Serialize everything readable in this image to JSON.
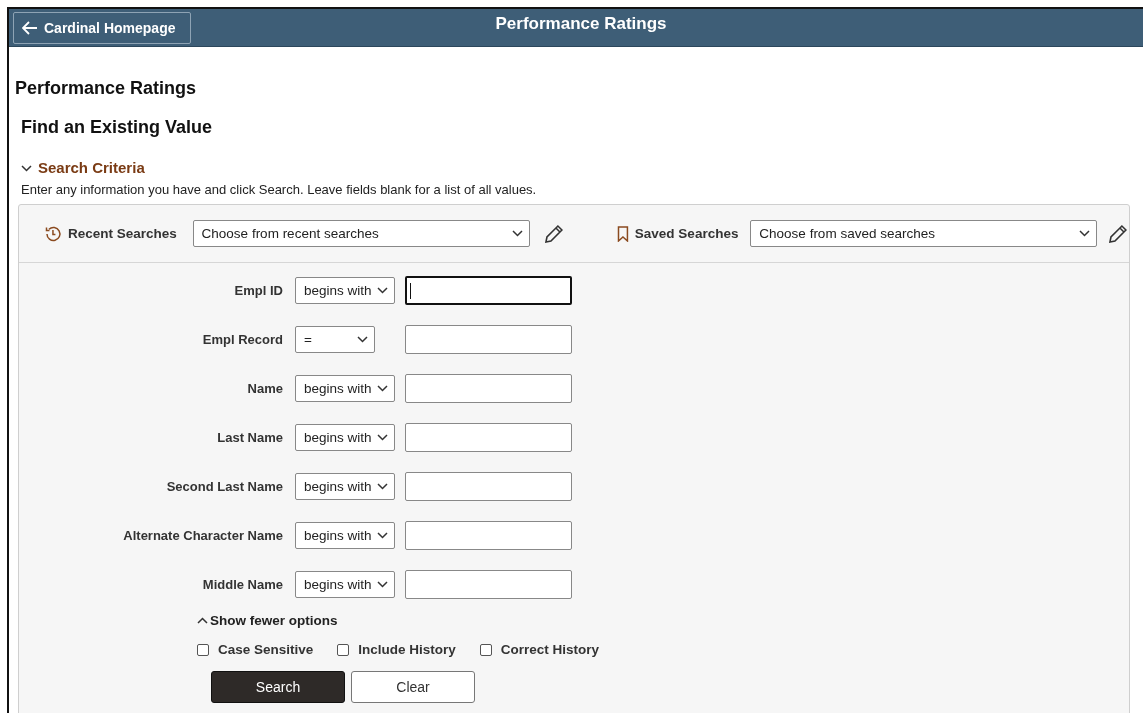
{
  "header": {
    "back_button": "Cardinal Homepage",
    "title": "Performance Ratings"
  },
  "page_title": "Performance Ratings",
  "subtitle": "Find an Existing Value",
  "section": {
    "title": "Search Criteria",
    "expanded": true,
    "instructions": "Enter any information you have and click Search. Leave fields blank for a list of all values."
  },
  "recent_searches": {
    "label": "Recent Searches",
    "value": "Choose from recent searches"
  },
  "saved_searches": {
    "label": "Saved Searches",
    "value": "Choose from saved searches"
  },
  "fields": [
    {
      "label": "Empl ID",
      "operator": "begins with",
      "focused": true
    },
    {
      "label": "Empl Record",
      "operator": "=",
      "focused": false
    },
    {
      "label": "Name",
      "operator": "begins with",
      "focused": false
    },
    {
      "label": "Last Name",
      "operator": "begins with",
      "focused": false
    },
    {
      "label": "Second Last Name",
      "operator": "begins with",
      "focused": false
    },
    {
      "label": "Alternate Character Name",
      "operator": "begins with",
      "focused": false
    },
    {
      "label": "Middle Name",
      "operator": "begins with",
      "focused": false
    }
  ],
  "options_toggle": {
    "label": "Show fewer options",
    "expanded": true
  },
  "checkboxes": [
    {
      "label": "Case Sensitive",
      "checked": false
    },
    {
      "label": "Include History",
      "checked": false
    },
    {
      "label": "Correct History",
      "checked": false
    }
  ],
  "buttons": [
    {
      "label": "Search",
      "kind": "primary"
    },
    {
      "label": "Clear",
      "kind": "secondary"
    }
  ]
}
